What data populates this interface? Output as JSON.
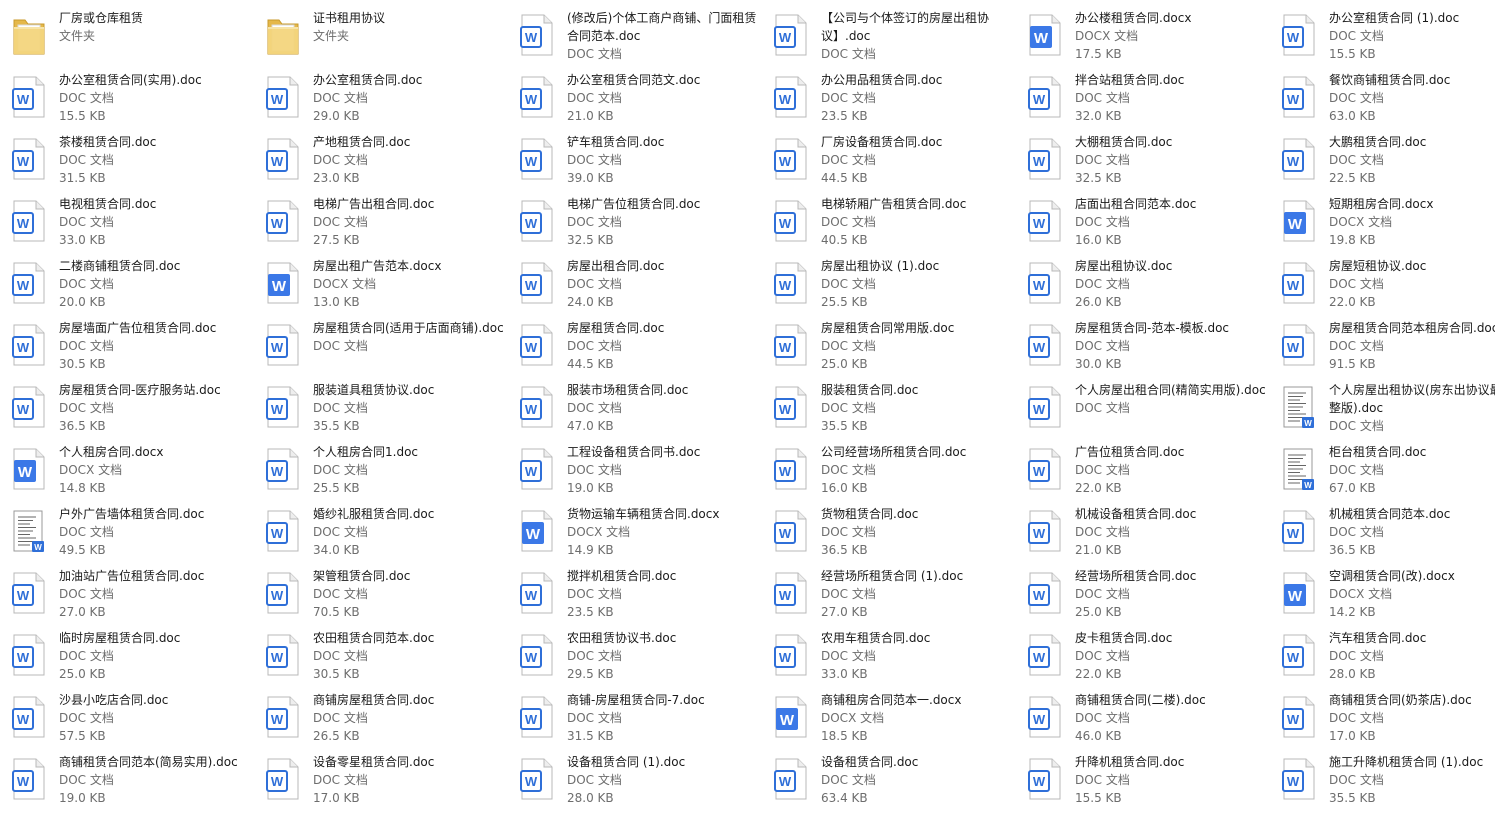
{
  "window": {
    "background": "#ffffff"
  },
  "colors": {
    "doc_blue": "#2f6fd8",
    "folder_yellow": "#f1cf6d",
    "text": "#1a1a1a",
    "subtext": "#6d6d6d"
  },
  "files": [
    {
      "name": "厂房或仓库租赁",
      "type": "文件夹",
      "size": "",
      "icon": "folder-icon"
    },
    {
      "name": "证书租用协议",
      "type": "文件夹",
      "size": "",
      "icon": "folder-icon"
    },
    {
      "name": "(修改后)个体工商户商铺、门面租赁合同范本.doc",
      "type": "DOC 文档",
      "size": "",
      "icon": "doc-icon"
    },
    {
      "name": "【公司与个体签订的房屋出租协议】.doc",
      "type": "DOC 文档",
      "size": "",
      "icon": "doc-icon"
    },
    {
      "name": "办公楼租赁合同.docx",
      "type": "DOCX 文档",
      "size": "17.5 KB",
      "icon": "docx-icon"
    },
    {
      "name": "办公室租赁合同 (1).doc",
      "type": "DOC 文档",
      "size": "15.5 KB",
      "icon": "doc-icon"
    },
    {
      "name": "办公室租赁合同(实用).doc",
      "type": "DOC 文档",
      "size": "15.5 KB",
      "icon": "doc-icon"
    },
    {
      "name": "办公室租赁合同.doc",
      "type": "DOC 文档",
      "size": "29.0 KB",
      "icon": "doc-icon"
    },
    {
      "name": "办公室租赁合同范文.doc",
      "type": "DOC 文档",
      "size": "21.0 KB",
      "icon": "doc-icon"
    },
    {
      "name": "办公用品租赁合同.doc",
      "type": "DOC 文档",
      "size": "23.5 KB",
      "icon": "doc-icon"
    },
    {
      "name": "拌合站租赁合同.doc",
      "type": "DOC 文档",
      "size": "32.0 KB",
      "icon": "doc-icon"
    },
    {
      "name": "餐饮商铺租赁合同.doc",
      "type": "DOC 文档",
      "size": "63.0 KB",
      "icon": "doc-icon"
    },
    {
      "name": "茶楼租赁合同.doc",
      "type": "DOC 文档",
      "size": "31.5 KB",
      "icon": "doc-icon"
    },
    {
      "name": "产地租赁合同.doc",
      "type": "DOC 文档",
      "size": "23.0 KB",
      "icon": "doc-icon"
    },
    {
      "name": "铲车租赁合同.doc",
      "type": "DOC 文档",
      "size": "39.0 KB",
      "icon": "doc-icon"
    },
    {
      "name": "厂房设备租赁合同.doc",
      "type": "DOC 文档",
      "size": "44.5 KB",
      "icon": "doc-icon"
    },
    {
      "name": "大棚租赁合同.doc",
      "type": "DOC 文档",
      "size": "32.5 KB",
      "icon": "doc-icon"
    },
    {
      "name": "大鹏租赁合同.doc",
      "type": "DOC 文档",
      "size": "22.5 KB",
      "icon": "doc-icon"
    },
    {
      "name": "电视租赁合同.doc",
      "type": "DOC 文档",
      "size": "33.0 KB",
      "icon": "doc-icon"
    },
    {
      "name": "电梯广告出租合同.doc",
      "type": "DOC 文档",
      "size": "27.5 KB",
      "icon": "doc-icon"
    },
    {
      "name": "电梯广告位租赁合同.doc",
      "type": "DOC 文档",
      "size": "32.5 KB",
      "icon": "doc-icon"
    },
    {
      "name": "电梯轿厢广告租赁合同.doc",
      "type": "DOC 文档",
      "size": "40.5 KB",
      "icon": "doc-icon"
    },
    {
      "name": "店面出租合同范本.doc",
      "type": "DOC 文档",
      "size": "16.0 KB",
      "icon": "doc-icon"
    },
    {
      "name": "短期租房合同.docx",
      "type": "DOCX 文档",
      "size": "19.8 KB",
      "icon": "docx-icon"
    },
    {
      "name": "二楼商铺租赁合同.doc",
      "type": "DOC 文档",
      "size": "20.0 KB",
      "icon": "doc-icon"
    },
    {
      "name": "房屋出租广告范本.docx",
      "type": "DOCX 文档",
      "size": "13.0 KB",
      "icon": "docx-icon"
    },
    {
      "name": "房屋出租合同.doc",
      "type": "DOC 文档",
      "size": "24.0 KB",
      "icon": "doc-icon"
    },
    {
      "name": "房屋出租协议 (1).doc",
      "type": "DOC 文档",
      "size": "25.5 KB",
      "icon": "doc-icon"
    },
    {
      "name": "房屋出租协议.doc",
      "type": "DOC 文档",
      "size": "26.0 KB",
      "icon": "doc-icon"
    },
    {
      "name": "房屋短租协议.doc",
      "type": "DOC 文档",
      "size": "22.0 KB",
      "icon": "doc-icon"
    },
    {
      "name": "房屋墙面广告位租赁合同.doc",
      "type": "DOC 文档",
      "size": "30.5 KB",
      "icon": "doc-icon"
    },
    {
      "name": "房屋租赁合同(适用于店面商铺).doc",
      "type": "DOC 文档",
      "size": "",
      "icon": "doc-icon"
    },
    {
      "name": "房屋租赁合同.doc",
      "type": "DOC 文档",
      "size": "44.5 KB",
      "icon": "doc-icon"
    },
    {
      "name": "房屋租赁合同常用版.doc",
      "type": "DOC 文档",
      "size": "25.0 KB",
      "icon": "doc-icon"
    },
    {
      "name": "房屋租赁合同-范本-模板.doc",
      "type": "DOC 文档",
      "size": "30.0 KB",
      "icon": "doc-icon"
    },
    {
      "name": "房屋租赁合同范本租房合同.doc",
      "type": "DOC 文档",
      "size": "91.5 KB",
      "icon": "doc-icon"
    },
    {
      "name": "房屋租赁合同-医疗服务站.doc",
      "type": "DOC 文档",
      "size": "36.5 KB",
      "icon": "doc-icon"
    },
    {
      "name": "服装道具租赁协议.doc",
      "type": "DOC 文档",
      "size": "35.5 KB",
      "icon": "doc-icon"
    },
    {
      "name": "服装市场租赁合同.doc",
      "type": "DOC 文档",
      "size": "47.0 KB",
      "icon": "doc-icon"
    },
    {
      "name": "服装租赁合同.doc",
      "type": "DOC 文档",
      "size": "35.5 KB",
      "icon": "doc-icon"
    },
    {
      "name": "个人房屋出租合同(精简实用版).doc",
      "type": "DOC 文档",
      "size": "",
      "icon": "doc-icon"
    },
    {
      "name": "个人房屋出租协议(房东出协议最完整版).doc",
      "type": "DOC 文档",
      "size": "",
      "icon": "thumb-icon"
    },
    {
      "name": "个人租房合同.docx",
      "type": "DOCX 文档",
      "size": "14.8 KB",
      "icon": "docx-icon"
    },
    {
      "name": "个人租房合同1.doc",
      "type": "DOC 文档",
      "size": "25.5 KB",
      "icon": "doc-icon"
    },
    {
      "name": "工程设备租赁合同书.doc",
      "type": "DOC 文档",
      "size": "19.0 KB",
      "icon": "doc-icon"
    },
    {
      "name": "公司经营场所租赁合同.doc",
      "type": "DOC 文档",
      "size": "16.0 KB",
      "icon": "doc-icon"
    },
    {
      "name": "广告位租赁合同.doc",
      "type": "DOC 文档",
      "size": "22.0 KB",
      "icon": "doc-icon"
    },
    {
      "name": "柜台租赁合同.doc",
      "type": "DOC 文档",
      "size": "67.0 KB",
      "icon": "thumb-icon"
    },
    {
      "name": "户外广告墙体租赁合同.doc",
      "type": "DOC 文档",
      "size": "49.5 KB",
      "icon": "thumb-icon"
    },
    {
      "name": "婚纱礼服租赁合同.doc",
      "type": "DOC 文档",
      "size": "34.0 KB",
      "icon": "doc-icon"
    },
    {
      "name": "货物运输车辆租赁合同.docx",
      "type": "DOCX 文档",
      "size": "14.9 KB",
      "icon": "docx-icon"
    },
    {
      "name": "货物租赁合同.doc",
      "type": "DOC 文档",
      "size": "36.5 KB",
      "icon": "doc-icon"
    },
    {
      "name": "机械设备租赁合同.doc",
      "type": "DOC 文档",
      "size": "21.0 KB",
      "icon": "doc-icon"
    },
    {
      "name": "机械租赁合同范本.doc",
      "type": "DOC 文档",
      "size": "36.5 KB",
      "icon": "doc-icon"
    },
    {
      "name": "加油站广告位租赁合同.doc",
      "type": "DOC 文档",
      "size": "27.0 KB",
      "icon": "doc-icon"
    },
    {
      "name": "架管租赁合同.doc",
      "type": "DOC 文档",
      "size": "70.5 KB",
      "icon": "doc-icon"
    },
    {
      "name": "搅拌机租赁合同.doc",
      "type": "DOC 文档",
      "size": "23.5 KB",
      "icon": "doc-icon"
    },
    {
      "name": "经营场所租赁合同 (1).doc",
      "type": "DOC 文档",
      "size": "27.0 KB",
      "icon": "doc-icon"
    },
    {
      "name": "经营场所租赁合同.doc",
      "type": "DOC 文档",
      "size": "25.0 KB",
      "icon": "doc-icon"
    },
    {
      "name": "空调租赁合同(改).docx",
      "type": "DOCX 文档",
      "size": "14.2 KB",
      "icon": "docx-icon"
    },
    {
      "name": "临时房屋租赁合同.doc",
      "type": "DOC 文档",
      "size": "25.0 KB",
      "icon": "doc-icon"
    },
    {
      "name": "农田租赁合同范本.doc",
      "type": "DOC 文档",
      "size": "30.5 KB",
      "icon": "doc-icon"
    },
    {
      "name": "农田租赁协议书.doc",
      "type": "DOC 文档",
      "size": "29.5 KB",
      "icon": "doc-icon"
    },
    {
      "name": "农用车租赁合同.doc",
      "type": "DOC 文档",
      "size": "33.0 KB",
      "icon": "doc-icon"
    },
    {
      "name": "皮卡租赁合同.doc",
      "type": "DOC 文档",
      "size": "22.0 KB",
      "icon": "doc-icon"
    },
    {
      "name": "汽车租赁合同.doc",
      "type": "DOC 文档",
      "size": "28.0 KB",
      "icon": "doc-icon"
    },
    {
      "name": "沙县小吃店合同.doc",
      "type": "DOC 文档",
      "size": "57.5 KB",
      "icon": "doc-icon"
    },
    {
      "name": "商铺房屋租赁合同.doc",
      "type": "DOC 文档",
      "size": "26.5 KB",
      "icon": "doc-icon"
    },
    {
      "name": "商铺-房屋租赁合同-7.doc",
      "type": "DOC 文档",
      "size": "31.5 KB",
      "icon": "doc-icon"
    },
    {
      "name": "商铺租房合同范本一.docx",
      "type": "DOCX 文档",
      "size": "18.5 KB",
      "icon": "docx-icon"
    },
    {
      "name": "商铺租赁合同(二楼).doc",
      "type": "DOC 文档",
      "size": "46.0 KB",
      "icon": "doc-icon"
    },
    {
      "name": "商铺租赁合同(奶茶店).doc",
      "type": "DOC 文档",
      "size": "17.0 KB",
      "icon": "doc-icon"
    },
    {
      "name": "商铺租赁合同范本(简易实用).doc",
      "type": "DOC 文档",
      "size": "19.0 KB",
      "icon": "doc-icon"
    },
    {
      "name": "设备零星租赁合同.doc",
      "type": "DOC 文档",
      "size": "17.0 KB",
      "icon": "doc-icon"
    },
    {
      "name": "设备租赁合同 (1).doc",
      "type": "DOC 文档",
      "size": "28.0 KB",
      "icon": "doc-icon"
    },
    {
      "name": "设备租赁合同.doc",
      "type": "DOC 文档",
      "size": "63.4 KB",
      "icon": "doc-icon"
    },
    {
      "name": "升降机租赁合同.doc",
      "type": "DOC 文档",
      "size": "15.5 KB",
      "icon": "doc-icon"
    },
    {
      "name": "施工升降机租赁合同 (1).doc",
      "type": "DOC 文档",
      "size": "35.5 KB",
      "icon": "doc-icon"
    }
  ]
}
